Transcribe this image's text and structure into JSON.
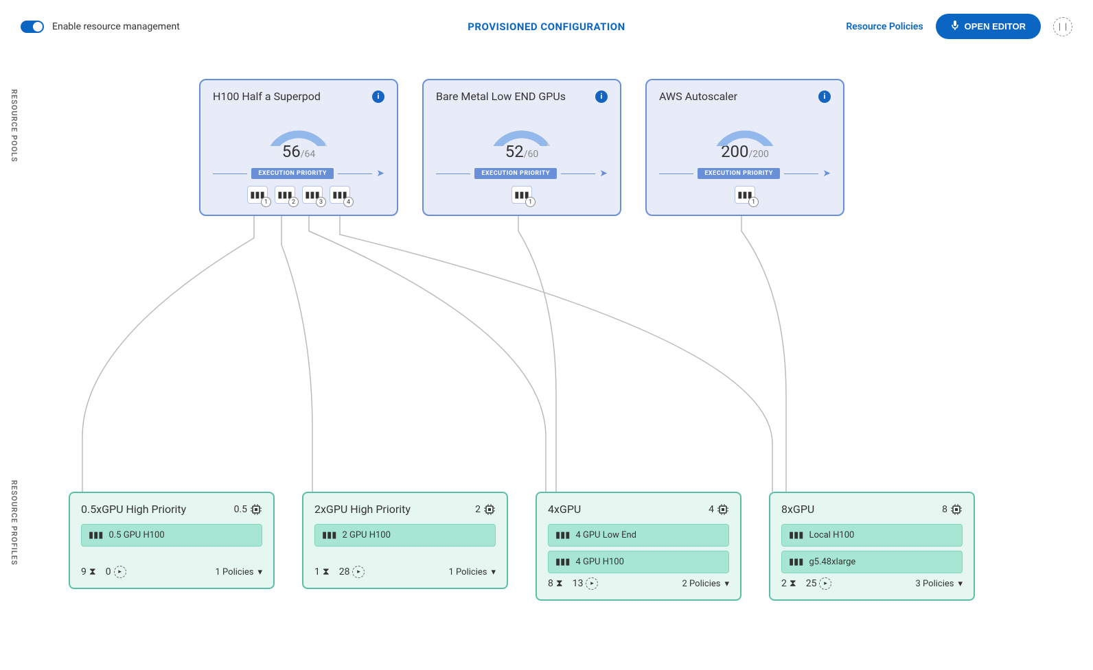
{
  "header": {
    "toggle_label": "Enable resource management",
    "title": "PROVISIONED CONFIGURATION",
    "resource_policies": "Resource Policies",
    "open_editor": "OPEN EDITOR"
  },
  "side_labels": {
    "pools": "RESOURCE POOLS",
    "profiles": "RESOURCE PROFILES"
  },
  "pools": [
    {
      "title": "H100 Half a Superpod",
      "value": "56",
      "total": "/64",
      "priority_label": "EXECUTION PRIORITY",
      "slots": [
        "1",
        "2",
        "3",
        "4"
      ],
      "gauge_pct": 0.88
    },
    {
      "title": "Bare Metal Low END GPUs",
      "value": "52",
      "total": "/60",
      "priority_label": "EXECUTION PRIORITY",
      "slots": [
        "1"
      ],
      "gauge_pct": 0.87
    },
    {
      "title": "AWS Autoscaler",
      "value": "200",
      "total": "/200",
      "priority_label": "EXECUTION PRIORITY",
      "slots": [
        "1"
      ],
      "gauge_pct": 1.0
    }
  ],
  "profiles": [
    {
      "title": "0.5xGPU High Priority",
      "gpu": "0.5",
      "items": [
        "0.5 GPU H100"
      ],
      "pending": "9",
      "running": "0",
      "policies": "1 Policies"
    },
    {
      "title": "2xGPU High Priority",
      "gpu": "2",
      "items": [
        "2 GPU H100"
      ],
      "pending": "1",
      "running": "28",
      "policies": "1 Policies"
    },
    {
      "title": "4xGPU",
      "gpu": "4",
      "items": [
        "4 GPU Low End",
        "4 GPU H100"
      ],
      "pending": "8",
      "running": "13",
      "policies": "2 Policies"
    },
    {
      "title": "8xGPU",
      "gpu": "8",
      "items": [
        "Local H100",
        "g5.48xlarge"
      ],
      "pending": "2",
      "running": "25",
      "policies": "3 Policies"
    }
  ]
}
